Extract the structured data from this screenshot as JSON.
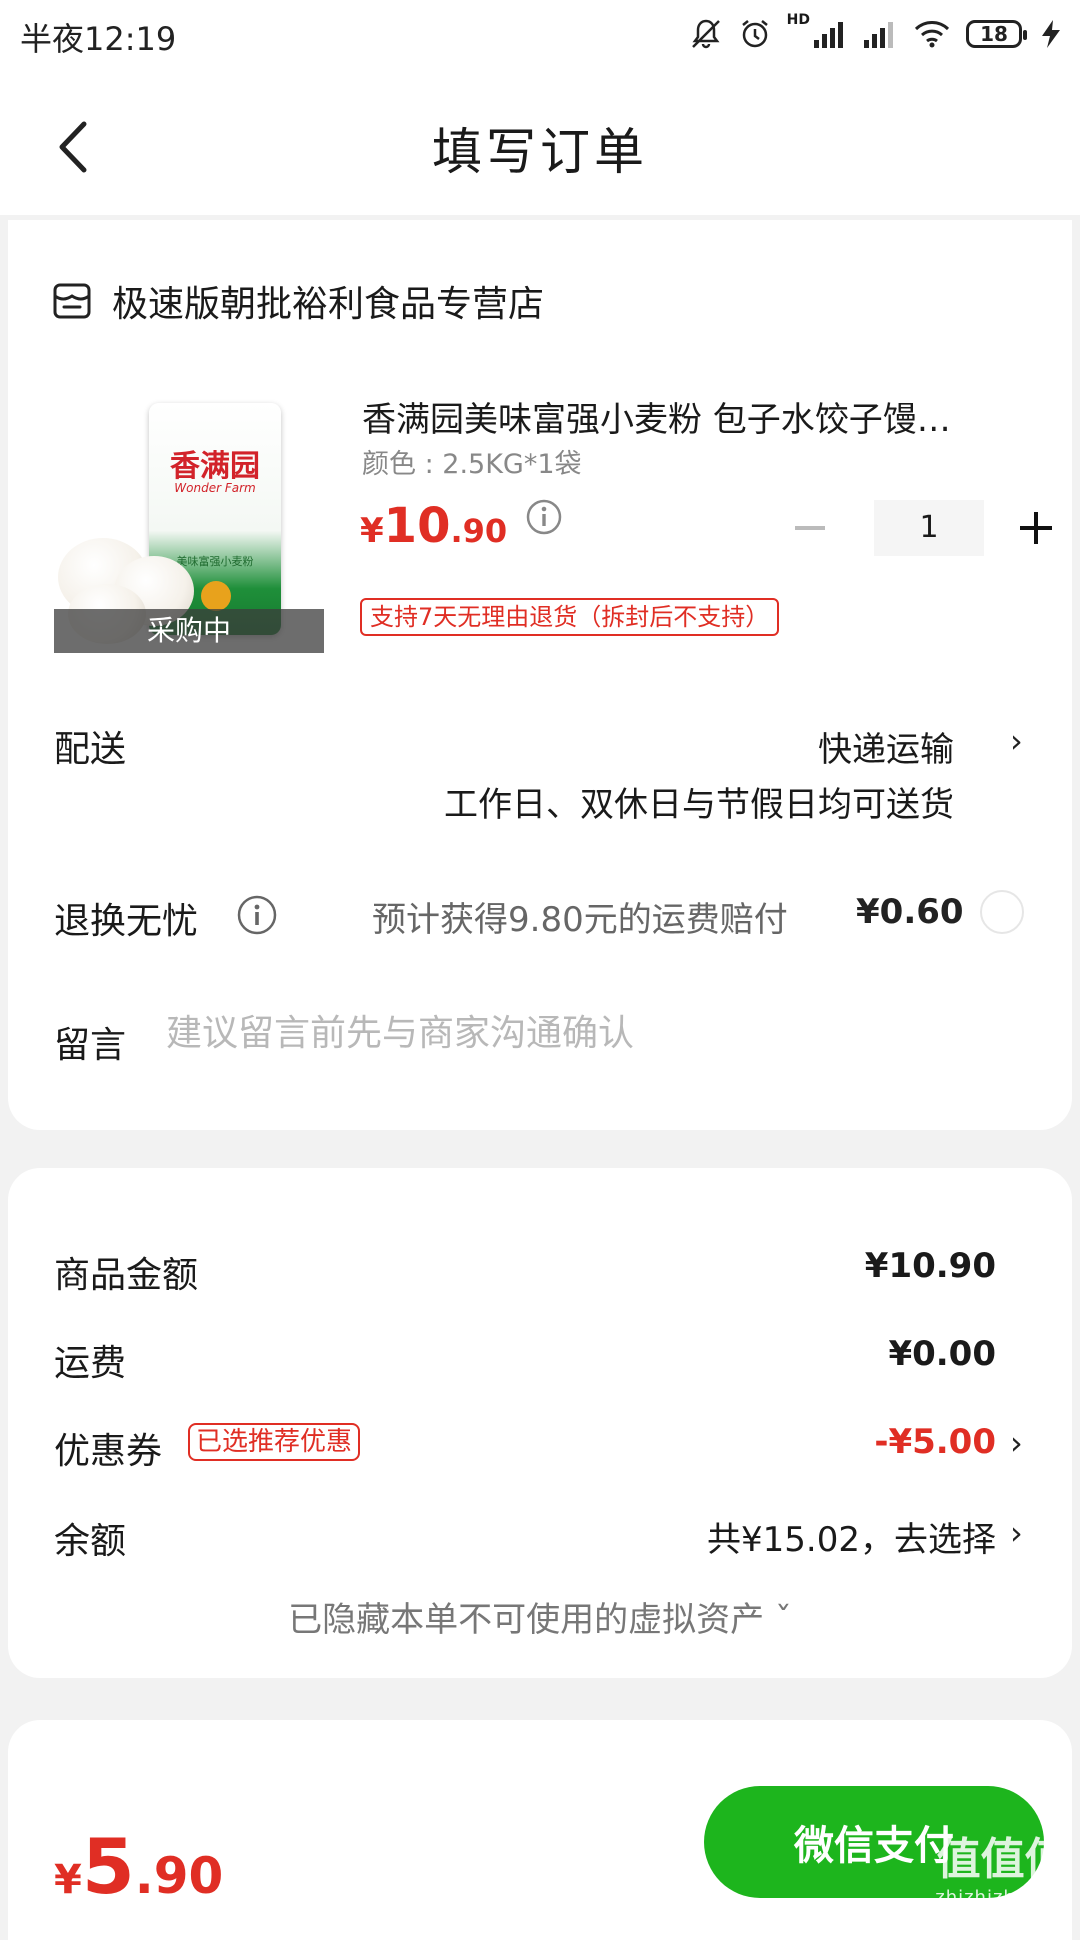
{
  "status_bar": {
    "time": "半夜12:19",
    "network": "HD",
    "battery": "18"
  },
  "header": {
    "title": "填写订单"
  },
  "store": {
    "name": "极速版朝批裕利食品专营店"
  },
  "product": {
    "title": "香满园美味富强小麦粉 包子水饺子馒…",
    "variant": "颜色 : 2.5KG*1袋",
    "price_currency": "¥",
    "price_int": "10",
    "price_dec": ".90",
    "quantity": "1",
    "status": "采购中",
    "return_policy": "支持7天无理由退货（拆封后不支持）",
    "image": {
      "brand": "香满园",
      "brand_en": "Wonder Farm",
      "name": "美味富强小麦粉"
    }
  },
  "delivery": {
    "label": "配送",
    "method": "快递运输",
    "note": "工作日、双休日与节假日均可送货"
  },
  "insurance": {
    "label": "退换无忧",
    "text": "预计获得9.80元的运费赔付",
    "price": "¥0.60"
  },
  "message": {
    "label": "留言",
    "placeholder": "建议留言前先与商家沟通确认"
  },
  "summary": {
    "goods_label": "商品金额",
    "goods_value": "¥10.90",
    "shipping_label": "运费",
    "shipping_value": "¥0.00",
    "coupon_label": "优惠券",
    "coupon_tag": "已选推荐优惠",
    "coupon_value": "-¥5.00",
    "balance_label": "余额",
    "balance_value": "共¥15.02，去选择",
    "hidden_assets": "已隐藏本单不可使用的虚拟资产 ˇ"
  },
  "footer": {
    "total_currency": "¥",
    "total_int": "5",
    "total_dec": ".90",
    "pay_label": "微信支付"
  },
  "watermark": {
    "text": "值值值",
    "url": "zhizhizhi.com"
  },
  "colors": {
    "accent": "#e02e24",
    "pay_green": "#1db51d"
  }
}
